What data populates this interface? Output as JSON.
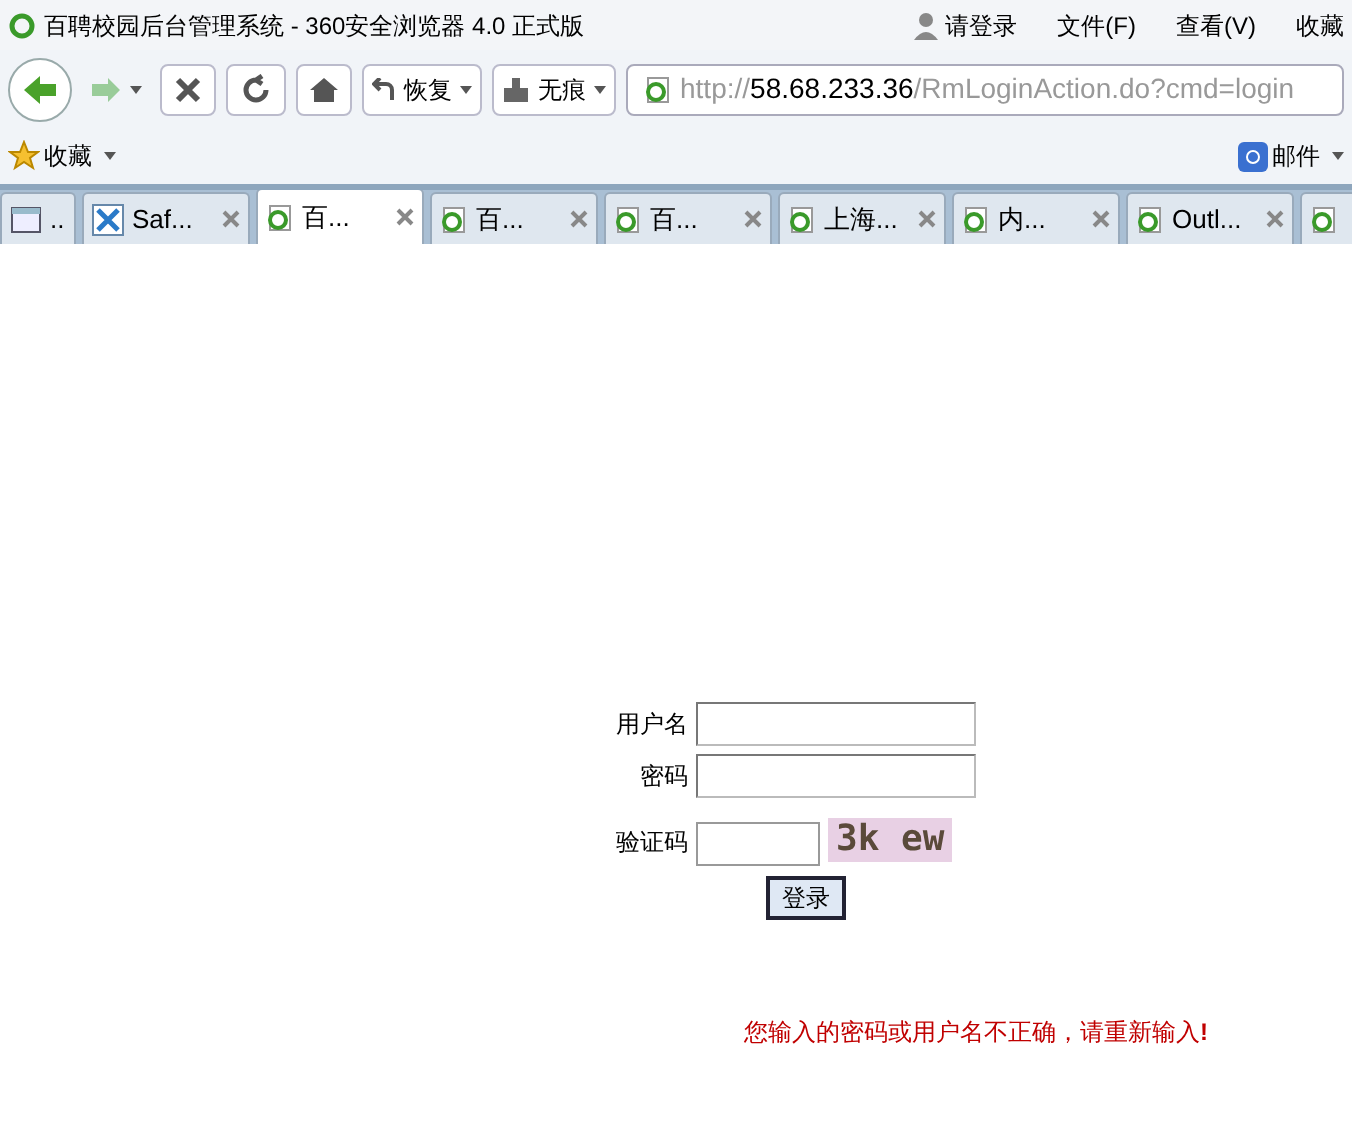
{
  "window": {
    "title": "百聘校园后台管理系统 - 360安全浏览器 4.0 正式版"
  },
  "title_bar": {
    "login": "请登录",
    "menus": [
      "文件(F)",
      "查看(V)",
      "收藏"
    ]
  },
  "toolbar": {
    "restore": "恢复",
    "incognito": "无痕",
    "url_scheme": "http://",
    "url_host": "58.68.233.36",
    "url_path": "/RmLoginAction.do?cmd=login"
  },
  "bookmarks_bar": {
    "favorites": "收藏",
    "mail": "邮件"
  },
  "tabs": [
    {
      "kind": "panel",
      "label": "..",
      "selected": false
    },
    {
      "kind": "x",
      "label": "Saf...",
      "selected": false
    },
    {
      "kind": "ie",
      "label": "百...",
      "selected": true
    },
    {
      "kind": "ie",
      "label": "百...",
      "selected": false
    },
    {
      "kind": "ie",
      "label": "百...",
      "selected": false
    },
    {
      "kind": "ie",
      "label": "上海...",
      "selected": false
    },
    {
      "kind": "ie",
      "label": "内...",
      "selected": false
    },
    {
      "kind": "ie",
      "label": "Outl...",
      "selected": false
    },
    {
      "kind": "ie",
      "selected": false
    }
  ],
  "form": {
    "username_label": "用户名",
    "password_label": "密码",
    "captcha_label": "验证码",
    "captcha_text": "3k ew",
    "submit": "登录"
  },
  "error_message": "您输入的密码或用户名不正确，请重新输入**!**"
}
